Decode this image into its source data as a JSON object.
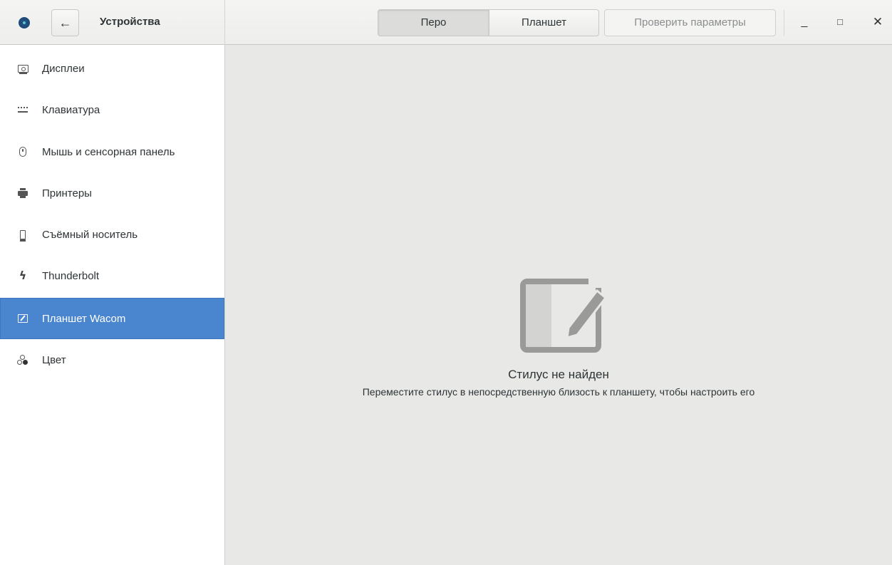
{
  "header": {
    "title": "Устройства",
    "back_icon": "←",
    "tabs": [
      {
        "label": "Перо",
        "selected": true
      },
      {
        "label": "Планшет",
        "selected": false
      }
    ],
    "check_button": "Проверить параметры",
    "window_controls": {
      "minimize": "_",
      "maximize": "□",
      "close": "✕"
    }
  },
  "sidebar": {
    "items": [
      {
        "label": "Дисплеи",
        "icon": "display-icon"
      },
      {
        "label": "Клавиатура",
        "icon": "keyboard-icon"
      },
      {
        "label": "Мышь и сенсорная панель",
        "icon": "mouse-icon"
      },
      {
        "label": "Принтеры",
        "icon": "printer-icon"
      },
      {
        "label": "Съёмный носитель",
        "icon": "removable-media-icon"
      },
      {
        "label": "Thunderbolt",
        "icon": "thunderbolt-icon"
      },
      {
        "label": "Планшет Wacom",
        "icon": "tablet-icon",
        "selected": true
      },
      {
        "label": "Цвет",
        "icon": "color-icon"
      }
    ]
  },
  "main": {
    "empty_title": "Стилус не найден",
    "empty_subtitle": "Переместите стилус в непосредственную близость к планшету, чтобы настроить его"
  },
  "colors": {
    "accent": "#4a86cf",
    "background": "#e8e8e7",
    "text": "#2e3436"
  }
}
